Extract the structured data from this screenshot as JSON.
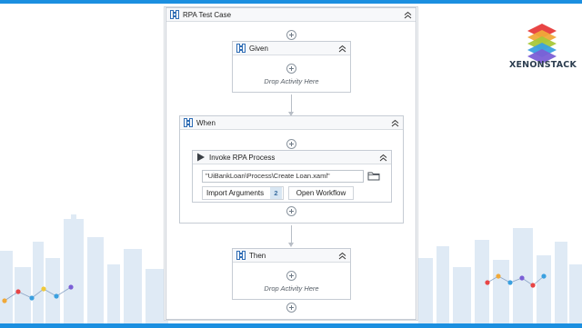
{
  "brand": {
    "name": "XENONSTACK",
    "logo_icon": "stacked-layers-logo"
  },
  "colors": {
    "accent": "#1b8fe0",
    "skyline": "#dbe8f4"
  },
  "workflow": {
    "title": "RPA Test Case",
    "given": {
      "title": "Given",
      "drop_text": "Drop Activity Here"
    },
    "when": {
      "title": "When",
      "activity": {
        "title": "Invoke RPA Process",
        "path_value": "\"UiBankLoan\\Process\\Create Loan.xaml\"",
        "import_label": "Import Arguments",
        "import_count": "2",
        "open_label": "Open Workflow"
      }
    },
    "then": {
      "title": "Then",
      "drop_text": "Drop Activity Here"
    }
  }
}
